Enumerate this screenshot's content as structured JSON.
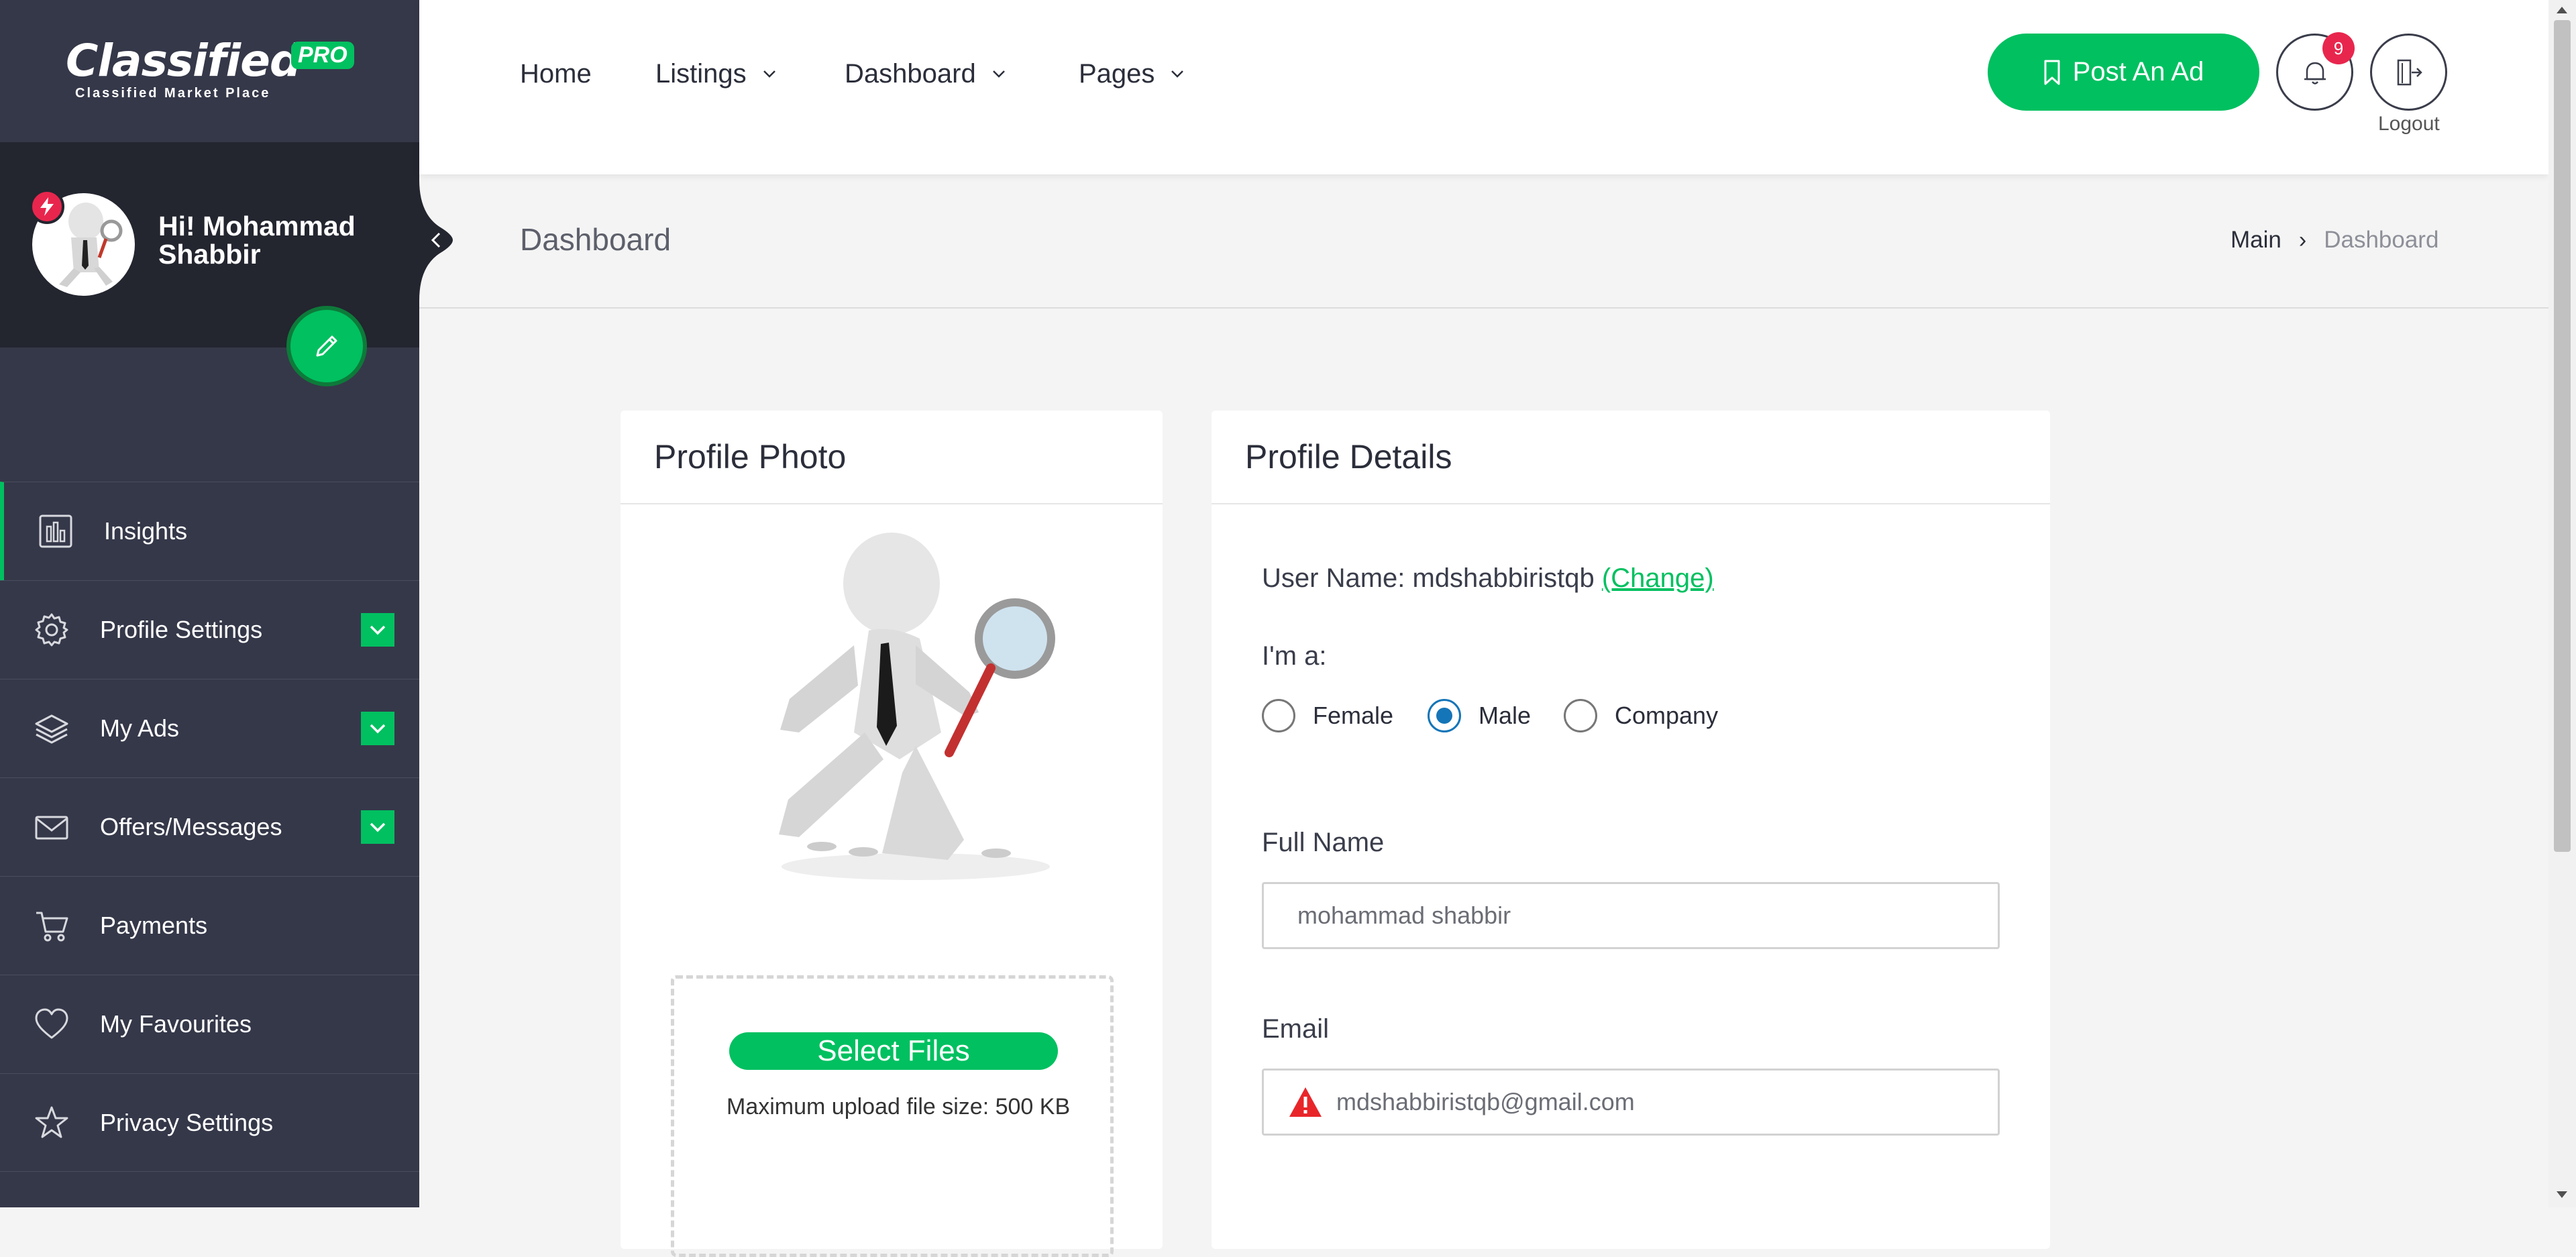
{
  "brand": {
    "name": "Classified",
    "badge": "PRO",
    "tagline": "Classified Market Place"
  },
  "user": {
    "greeting": "Hi! Mohammad Shabbir",
    "avatar_icon": "user-magnifier-avatar"
  },
  "sidebar": {
    "items": [
      {
        "label": "Insights",
        "icon": "bar-chart-icon",
        "active": true,
        "expandable": false
      },
      {
        "label": "Profile Settings",
        "icon": "gear-icon",
        "active": false,
        "expandable": true
      },
      {
        "label": "My Ads",
        "icon": "layers-icon",
        "active": false,
        "expandable": true
      },
      {
        "label": "Offers/Messages",
        "icon": "envelope-icon",
        "active": false,
        "expandable": true
      },
      {
        "label": "Payments",
        "icon": "cart-icon",
        "active": false,
        "expandable": false
      },
      {
        "label": "My Favourites",
        "icon": "heart-icon",
        "active": false,
        "expandable": false
      },
      {
        "label": "Privacy Settings",
        "icon": "star-icon",
        "active": false,
        "expandable": false
      }
    ]
  },
  "header": {
    "nav": [
      {
        "label": "Home",
        "dropdown": false
      },
      {
        "label": "Listings",
        "dropdown": true
      },
      {
        "label": "Dashboard",
        "dropdown": true
      },
      {
        "label": "Pages",
        "dropdown": true
      }
    ],
    "post_ad_label": "Post An Ad",
    "notification_count": "9",
    "logout_label": "Logout"
  },
  "page": {
    "title": "Dashboard",
    "breadcrumb": {
      "main": "Main",
      "separator": "›",
      "current": "Dashboard"
    }
  },
  "photo_card": {
    "title": "Profile Photo",
    "select_files_label": "Select Files",
    "max_size_text": "Maximum upload file size: 500 KB"
  },
  "details_card": {
    "title": "Profile Details",
    "username_label": "User Name: mdshabbiristqb",
    "change_link": "(Change)",
    "gender_label": "I'm a:",
    "gender_options": [
      {
        "label": "Female",
        "checked": false
      },
      {
        "label": "Male",
        "checked": true
      },
      {
        "label": "Company",
        "checked": false
      }
    ],
    "fullname_label": "Full Name",
    "fullname_value": "mohammad shabbir",
    "email_label": "Email",
    "email_value": "mdshabbiristqb@gmail.com",
    "email_warning_icon": "warning-icon"
  },
  "colors": {
    "accent": "#00c060",
    "sidebar_bg": "#353849",
    "sidebar_profile_bg": "#23252f",
    "badge_red": "#e8264d",
    "radio_blue": "#1475b8"
  }
}
